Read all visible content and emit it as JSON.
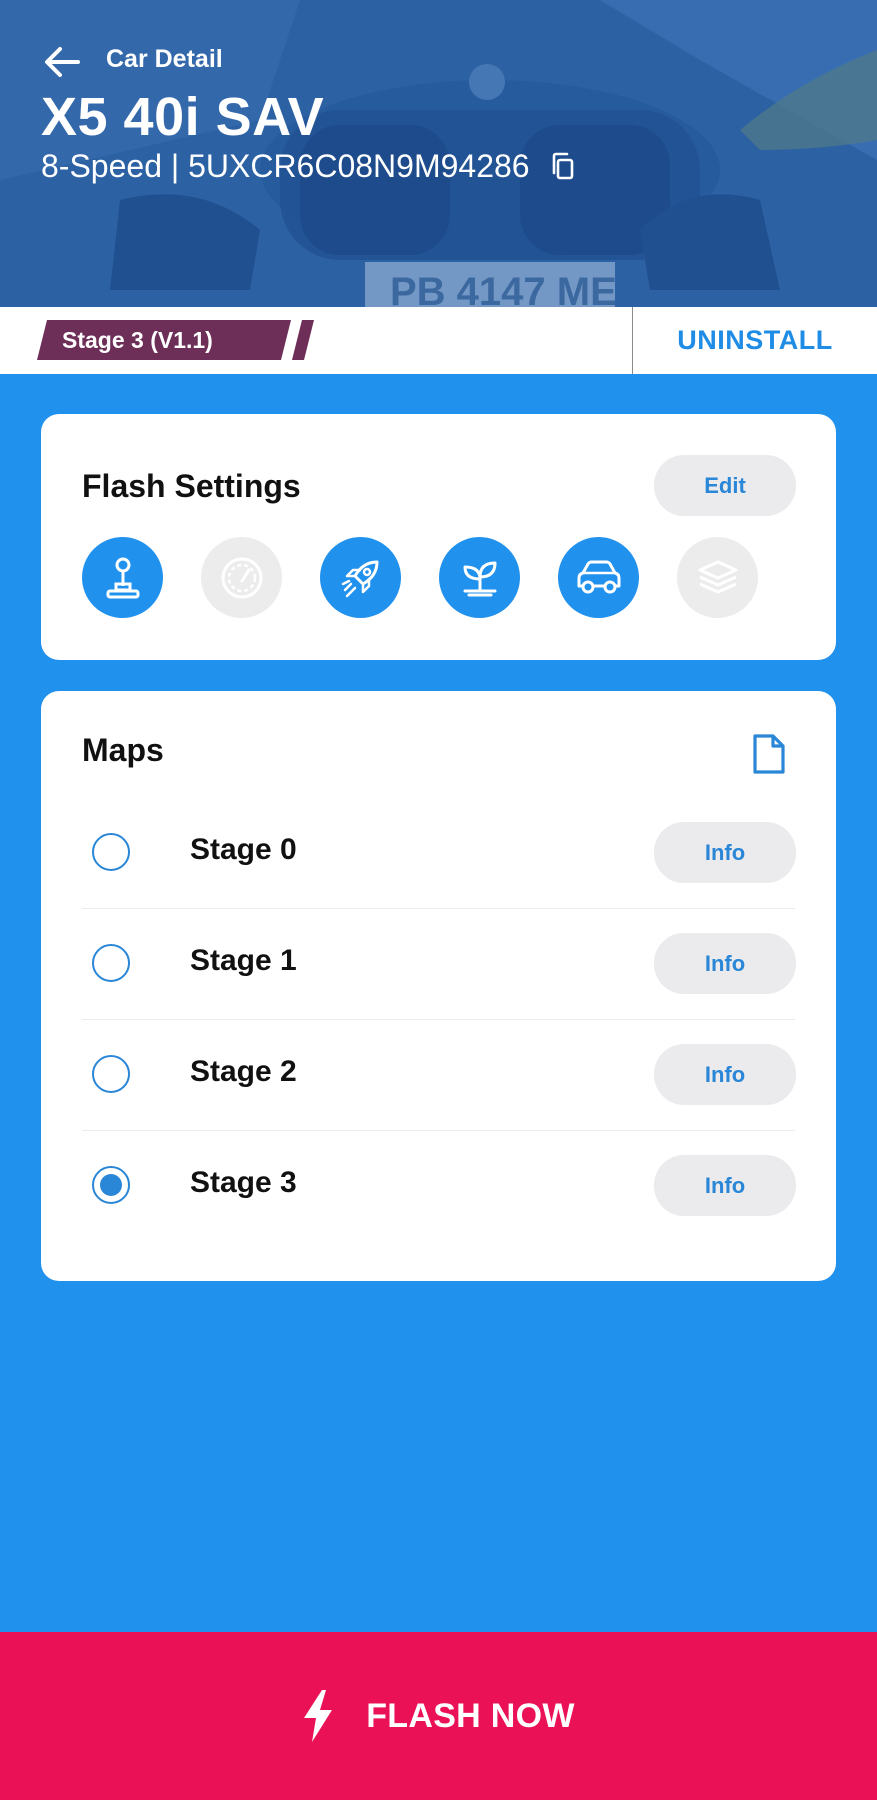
{
  "header": {
    "crumb": "Car Detail",
    "car_name": "X5 40i SAV",
    "transmission": "8-Speed",
    "separator": " | ",
    "vin": "5UXCR6C08N9M94286"
  },
  "stage_bar": {
    "current_stage": "Stage 3 (V1.1)",
    "uninstall_label": "UNINSTALL"
  },
  "flash_settings": {
    "title": "Flash Settings",
    "edit_label": "Edit",
    "icons": [
      {
        "name": "joystick-icon",
        "state": "on"
      },
      {
        "name": "speedometer-icon",
        "state": "off"
      },
      {
        "name": "rocket-icon",
        "state": "on"
      },
      {
        "name": "eco-sprout-icon",
        "state": "on"
      },
      {
        "name": "car-icon",
        "state": "on"
      },
      {
        "name": "layers-icon",
        "state": "off"
      }
    ]
  },
  "maps": {
    "title": "Maps",
    "info_label": "Info",
    "items": [
      {
        "label": "Stage 0",
        "selected": false
      },
      {
        "label": "Stage 1",
        "selected": false
      },
      {
        "label": "Stage 2",
        "selected": false
      },
      {
        "label": "Stage 3",
        "selected": true
      }
    ]
  },
  "footer": {
    "flash_label": "FLASH NOW"
  },
  "colors": {
    "background": "#2191ee",
    "accent": "#2a86d6",
    "stage_pill": "#6d2f57",
    "flash": "#ea1157"
  }
}
